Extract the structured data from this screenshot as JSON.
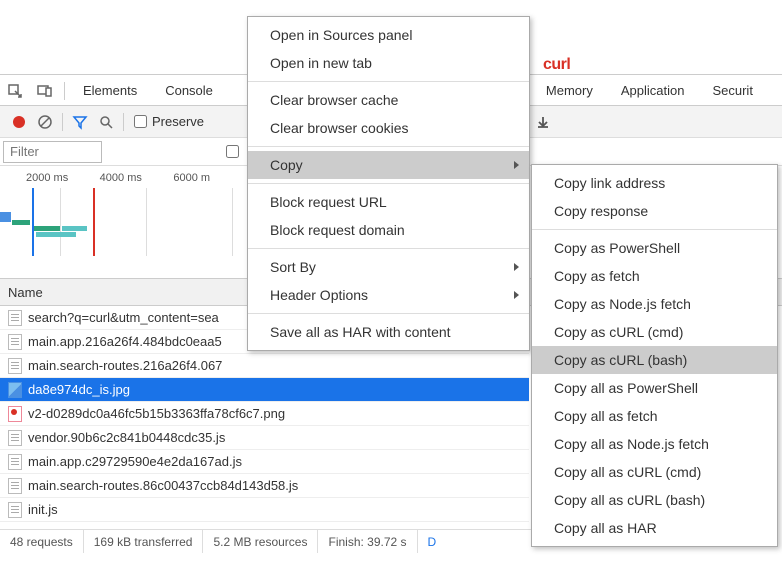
{
  "top_red": "curl",
  "tabs": {
    "inspect": "Elements",
    "console": "Console",
    "memory": "Memory",
    "app": "Application",
    "security": "Securit"
  },
  "tool": {
    "preserve": "Preserve"
  },
  "filter": {
    "placeholder": "Filter"
  },
  "timeline": {
    "t1": "2000 ms",
    "t2": "4000 ms",
    "t3": "6000 m"
  },
  "list_header": "Name",
  "files": [
    "search?q=curl&utm_content=sea",
    "main.app.216a26f4.484bdc0eaa5",
    "main.search-routes.216a26f4.067",
    "da8e974dc_is.jpg",
    "v2-d0289dc0a46fc5b15b3363ffa78cf6c7.png",
    "vendor.90b6c2c841b0448cdc35.js",
    "main.app.c29729590e4e2da167ad.js",
    "main.search-routes.86c00437ccb84d143d58.js",
    "init.js"
  ],
  "status": {
    "req": "48 requests",
    "xfer": "169 kB transferred",
    "res": "5.2 MB resources",
    "fin": "Finish: 39.72 s",
    "dom": "D"
  },
  "menu1": {
    "open_sources": "Open in Sources panel",
    "open_tab": "Open in new tab",
    "clear_cache": "Clear browser cache",
    "clear_cookies": "Clear browser cookies",
    "copy": "Copy",
    "block_url": "Block request URL",
    "block_domain": "Block request domain",
    "sort": "Sort By",
    "header_opts": "Header Options",
    "save_har": "Save all as HAR with content"
  },
  "menu2": {
    "link": "Copy link address",
    "resp": "Copy response",
    "ps": "Copy as PowerShell",
    "fetch": "Copy as fetch",
    "node": "Copy as Node.js fetch",
    "curl_cmd": "Copy as cURL (cmd)",
    "curl_bash": "Copy as cURL (bash)",
    "all_ps": "Copy all as PowerShell",
    "all_fetch": "Copy all as fetch",
    "all_node": "Copy all as Node.js fetch",
    "all_curl_cmd": "Copy all as cURL (cmd)",
    "all_curl_bash": "Copy all as cURL (bash)",
    "all_har": "Copy all as HAR"
  }
}
